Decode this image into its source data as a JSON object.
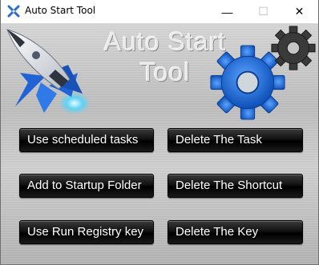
{
  "window": {
    "title": "Auto Start Tool",
    "app_icon": "scissors-cross-icon",
    "controls": {
      "minimize": "—",
      "maximize": "☐",
      "close": "✕"
    }
  },
  "header": {
    "title_line1": "Auto Start",
    "title_line2": "Tool",
    "graphics": [
      "rocket-icon",
      "gear-icon",
      "gear-icon"
    ]
  },
  "buttons": {
    "use_scheduled_tasks": "Use scheduled tasks",
    "delete_the_task": "Delete The Task",
    "add_to_startup_folder": "Add to Startup Folder",
    "delete_the_shortcut": "Delete The Shortcut",
    "use_run_registry_key": "Use Run Registry key",
    "delete_the_key": "Delete The Key"
  },
  "colors": {
    "button_bg": "#000000",
    "button_text": "#ffffff",
    "panel_bg": "#c8c8c8",
    "gear_blue": "#1f6fe0"
  }
}
